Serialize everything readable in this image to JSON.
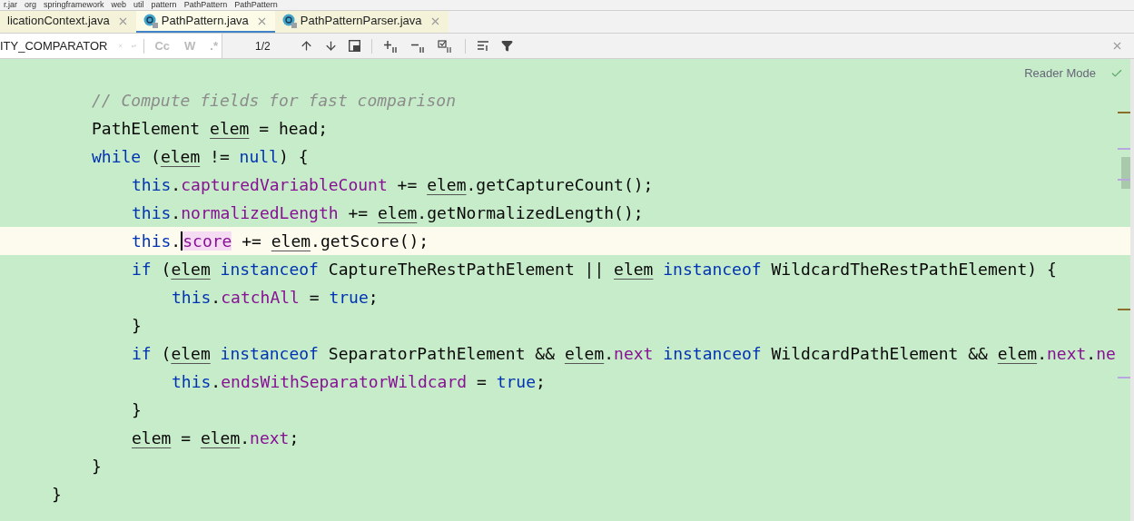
{
  "breadcrumb": [
    "r.jar",
    "org",
    "springframework",
    "web",
    "util",
    "pattern",
    "PathPattern",
    "PathPattern"
  ],
  "tabs": [
    {
      "label": "licationContext.java",
      "selected": false,
      "icon": false
    },
    {
      "label": "PathPattern.java",
      "selected": true,
      "icon": true
    },
    {
      "label": "PathPatternParser.java",
      "selected": false,
      "icon": true
    }
  ],
  "search": {
    "value": "ITY_COMPARATOR",
    "options": [
      "Cc",
      "W",
      ".*"
    ],
    "match_count": "1/2"
  },
  "reader_mode": "Reader Mode",
  "code_lines": [
    {
      "children": [
        {
          "current": false,
          "tokens": [
            {
              "kind": "comment",
              "text": "// Compute fields for fast comparison"
            }
          ]
        },
        {
          "current": false,
          "tokens": [
            {
              "kind": "plain",
              "text": "PathElement "
            },
            {
              "kind": "variable",
              "text": "elem"
            },
            {
              "kind": "plain",
              "text": " = head;"
            }
          ]
        },
        {
          "current": false,
          "tokens": [
            {
              "kind": "keyword",
              "text": "while"
            },
            {
              "kind": "plain",
              "text": " ("
            },
            {
              "kind": "variable",
              "text": "elem"
            },
            {
              "kind": "plain",
              "text": " != "
            },
            {
              "kind": "keyword",
              "text": "null"
            },
            {
              "kind": "plain",
              "text": ") {"
            }
          ],
          "children": [
            {
              "current": false,
              "tokens": [
                {
                  "kind": "keyword",
                  "text": "this"
                },
                {
                  "kind": "plain",
                  "text": "."
                },
                {
                  "kind": "field",
                  "text": "capturedVariableCount"
                },
                {
                  "kind": "plain",
                  "text": " += "
                },
                {
                  "kind": "variable",
                  "text": "elem"
                },
                {
                  "kind": "plain",
                  "text": ".getCaptureCount();"
                }
              ]
            },
            {
              "current": false,
              "tokens": [
                {
                  "kind": "keyword",
                  "text": "this"
                },
                {
                  "kind": "plain",
                  "text": "."
                },
                {
                  "kind": "field",
                  "text": "normalizedLength"
                },
                {
                  "kind": "plain",
                  "text": " += "
                },
                {
                  "kind": "variable",
                  "text": "elem"
                },
                {
                  "kind": "plain",
                  "text": ".getNormalizedLength();"
                }
              ]
            },
            {
              "current": true,
              "tokens": [
                {
                  "kind": "keyword",
                  "text": "this"
                },
                {
                  "kind": "plain",
                  "text": "."
                },
                {
                  "kind": "caret-field",
                  "text": "score"
                },
                {
                  "kind": "plain",
                  "text": " += "
                },
                {
                  "kind": "variable",
                  "text": "elem"
                },
                {
                  "kind": "plain",
                  "text": ".getScore();"
                }
              ]
            },
            {
              "current": false,
              "tokens": [
                {
                  "kind": "keyword",
                  "text": "if"
                },
                {
                  "kind": "plain",
                  "text": " ("
                },
                {
                  "kind": "variable",
                  "text": "elem"
                },
                {
                  "kind": "keyword",
                  "text": " instanceof"
                },
                {
                  "kind": "plain",
                  "text": " CaptureTheRestPathElement || "
                },
                {
                  "kind": "variable",
                  "text": "elem"
                },
                {
                  "kind": "keyword",
                  "text": " instanceof"
                },
                {
                  "kind": "plain",
                  "text": " WildcardTheRestPathElement) {"
                }
              ],
              "children": [
                {
                  "current": false,
                  "tokens": [
                    {
                      "kind": "keyword",
                      "text": "this"
                    },
                    {
                      "kind": "plain",
                      "text": "."
                    },
                    {
                      "kind": "field",
                      "text": "catchAll"
                    },
                    {
                      "kind": "plain",
                      "text": " = "
                    },
                    {
                      "kind": "keyword",
                      "text": "true"
                    },
                    {
                      "kind": "plain",
                      "text": ";"
                    }
                  ]
                }
              ]
            },
            {
              "current": false,
              "tokens": [
                {
                  "kind": "plain",
                  "text": "}"
                }
              ]
            },
            {
              "current": false,
              "tokens": [
                {
                  "kind": "keyword",
                  "text": "if"
                },
                {
                  "kind": "plain",
                  "text": " ("
                },
                {
                  "kind": "variable",
                  "text": "elem"
                },
                {
                  "kind": "keyword",
                  "text": " instanceof"
                },
                {
                  "kind": "plain",
                  "text": " SeparatorPathElement && "
                },
                {
                  "kind": "variable",
                  "text": "elem"
                },
                {
                  "kind": "plain",
                  "text": "."
                },
                {
                  "kind": "field",
                  "text": "next"
                },
                {
                  "kind": "keyword",
                  "text": " instanceof"
                },
                {
                  "kind": "plain",
                  "text": " WildcardPathElement && "
                },
                {
                  "kind": "variable",
                  "text": "elem"
                },
                {
                  "kind": "plain",
                  "text": "."
                },
                {
                  "kind": "field",
                  "text": "next"
                },
                {
                  "kind": "plain",
                  "text": "."
                },
                {
                  "kind": "field",
                  "text": "ne"
                }
              ],
              "children": [
                {
                  "current": false,
                  "tokens": [
                    {
                      "kind": "keyword",
                      "text": "this"
                    },
                    {
                      "kind": "plain",
                      "text": "."
                    },
                    {
                      "kind": "field",
                      "text": "endsWithSeparatorWildcard"
                    },
                    {
                      "kind": "plain",
                      "text": " = "
                    },
                    {
                      "kind": "keyword",
                      "text": "true"
                    },
                    {
                      "kind": "plain",
                      "text": ";"
                    }
                  ]
                }
              ]
            },
            {
              "current": false,
              "tokens": [
                {
                  "kind": "plain",
                  "text": "}"
                }
              ]
            },
            {
              "current": false,
              "tokens": [
                {
                  "kind": "variable",
                  "text": "elem"
                },
                {
                  "kind": "plain",
                  "text": " = "
                },
                {
                  "kind": "variable",
                  "text": "elem"
                },
                {
                  "kind": "plain",
                  "text": "."
                },
                {
                  "kind": "field",
                  "text": "next"
                },
                {
                  "kind": "plain",
                  "text": ";"
                }
              ]
            }
          ]
        },
        {
          "current": false,
          "tokens": [
            {
              "kind": "plain",
              "text": "}"
            }
          ]
        }
      ]
    },
    {
      "current": false,
      "tokens": [
        {
          "kind": "plain",
          "text": "}"
        }
      ]
    }
  ]
}
